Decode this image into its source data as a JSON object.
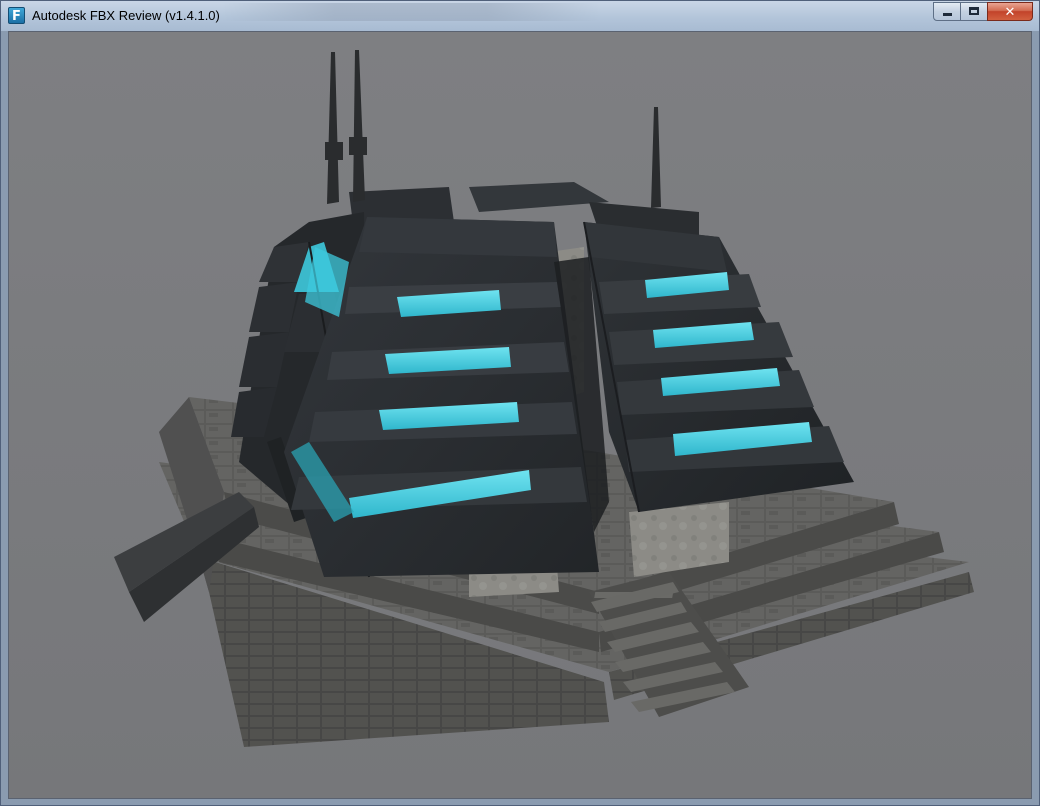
{
  "window": {
    "title": "Autodesk FBX Review (v1.4.1.0)",
    "app_icon_letter": "F",
    "controls": {
      "minimize": "minimize",
      "maximize": "maximize",
      "close": "✕"
    }
  },
  "viewport": {
    "scene": "3d-model-temple-pyramid",
    "background_color": "#7b7c7f",
    "accent_glow_color": "#3ec9dd",
    "panel_color": "#2a2d31",
    "stone_color": "#5e5e5c"
  }
}
